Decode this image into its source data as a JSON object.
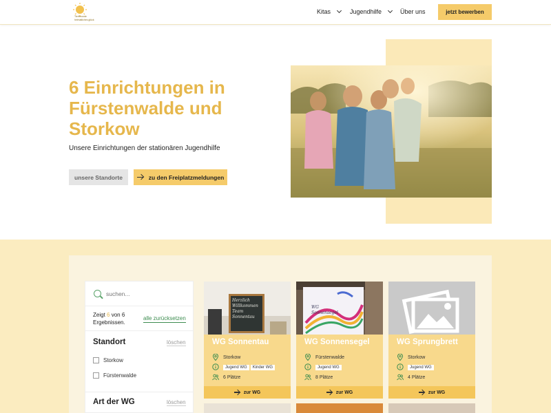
{
  "header": {
    "logo_caption_1": "Tierfreunde",
    "logo_caption_2": "heimatliches glück",
    "nav": [
      {
        "label": "Kitas",
        "has_dropdown": true
      },
      {
        "label": "Jugendhilfe",
        "has_dropdown": true
      },
      {
        "label": "Über uns",
        "has_dropdown": false
      }
    ],
    "cta_label": "jetzt bewerben"
  },
  "hero": {
    "title": "6 Einrichtungen in Fürstenwalde und Storkow",
    "subtitle": "Unsere Einrichtungen der stationären Jugendhilfe",
    "btn_locations": "unsere Standorte",
    "btn_vacancies": "zu den Freiplatzmeldungen"
  },
  "filters": {
    "search_placeholder": "suchen...",
    "result_prefix": "Zeigt ",
    "result_count": "6",
    "result_suffix": " von 6 Ergebnissen.",
    "reset_label": "alle zurücksetzen",
    "groups": [
      {
        "heading": "Standort",
        "clear_label": "löschen",
        "options": [
          "Storkow",
          "Fürstenwalde"
        ]
      },
      {
        "heading": "Art der WG",
        "clear_label": "löschen",
        "options": []
      }
    ]
  },
  "cards": [
    {
      "title": "WG Sonnentau",
      "location": "Storkow",
      "tags": [
        "Jugend WG",
        "Kinder WG"
      ],
      "places": "6 Plätze",
      "button": "zur WG",
      "chalk_text": "Herzlich Willkommen Team Sonnentau"
    },
    {
      "title": "WG Sonnensegel",
      "location": "Fürstenwalde",
      "tags": [
        "Jugend WG"
      ],
      "places": "8 Plätze",
      "button": "zur WG",
      "canvas_text": "WG Sonnensegel"
    },
    {
      "title": "WG Sprungbrett",
      "location": "Storkow",
      "tags": [
        "Jugend WG"
      ],
      "places": "4 Plätze",
      "button": "zur WG"
    }
  ],
  "colors": {
    "brand_yellow": "#f5cb6a",
    "title_gold": "#e6b74c",
    "link_green": "#3c8c4f",
    "section_bg": "#fbecc0"
  }
}
